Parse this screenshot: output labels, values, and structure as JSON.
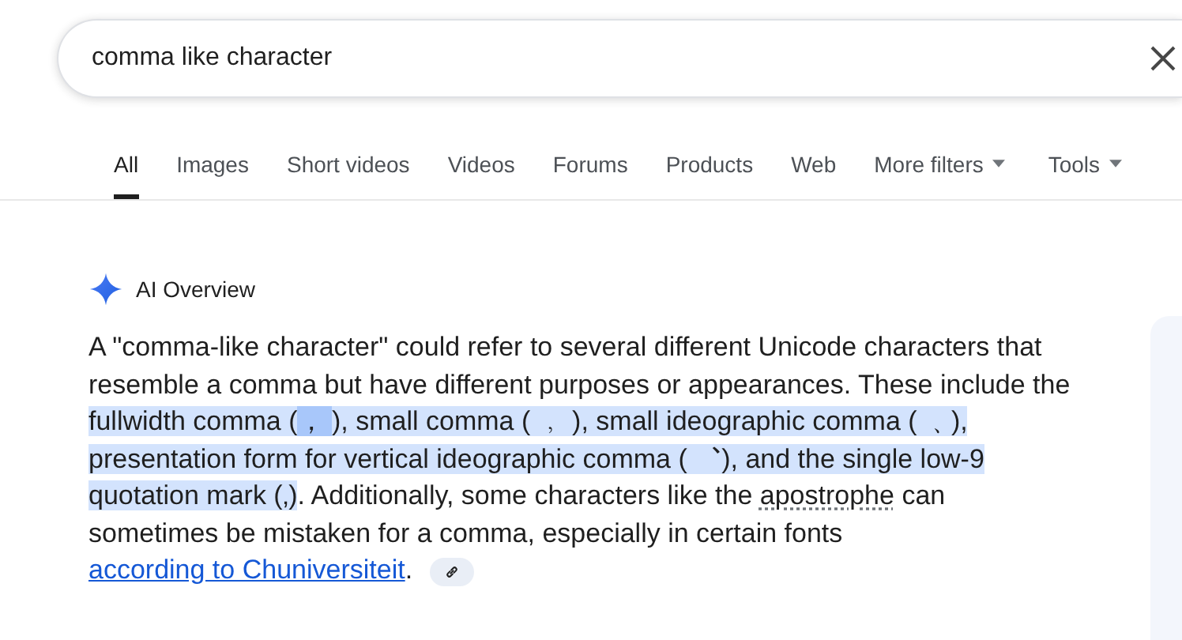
{
  "search": {
    "value": "comma like character"
  },
  "tabs": [
    {
      "label": "All",
      "selected": true,
      "kind": "plain"
    },
    {
      "label": "Images",
      "selected": false,
      "kind": "plain"
    },
    {
      "label": "Short videos",
      "selected": false,
      "kind": "plain"
    },
    {
      "label": "Videos",
      "selected": false,
      "kind": "plain"
    },
    {
      "label": "Forums",
      "selected": false,
      "kind": "plain"
    },
    {
      "label": "Products",
      "selected": false,
      "kind": "plain"
    },
    {
      "label": "Web",
      "selected": false,
      "kind": "plain"
    },
    {
      "label": "More filters",
      "selected": false,
      "kind": "menu"
    },
    {
      "label": "Tools",
      "selected": false,
      "kind": "menu"
    }
  ],
  "overview": {
    "title": "AI Overview",
    "paragraph": [
      {
        "text": "A \"comma-like character\" could refer to several different Unicode characters that resemble a comma but have different purposes or appearances. These include the ",
        "kind": "text",
        "highlighted": false,
        "focused": false
      },
      {
        "text": "fullwidth comma (",
        "kind": "text",
        "highlighted": true,
        "focused": false
      },
      {
        "text": "， ",
        "kind": "text",
        "highlighted": true,
        "focused": true
      },
      {
        "text": "), small comma ( ﹐ ), small ideographic comma ( ﹑), presentation form for vertical ideographic comma ( ︑), and the single low-9 quotation mark (‚)",
        "kind": "text",
        "highlighted": true,
        "focused": false
      },
      {
        "text": ". Additionally, some characters like the ",
        "kind": "text",
        "highlighted": false,
        "focused": false
      },
      {
        "text": "apostrophe",
        "kind": "term",
        "highlighted": false,
        "focused": false
      },
      {
        "text": " can sometimes be mistaken for a comma, especially in certain fonts ",
        "kind": "text",
        "highlighted": false,
        "focused": false
      },
      {
        "text": "according to Chuniversiteit",
        "kind": "link",
        "highlighted": false,
        "focused": false
      },
      {
        "text": ".",
        "kind": "text",
        "highlighted": false,
        "focused": false
      }
    ]
  }
}
